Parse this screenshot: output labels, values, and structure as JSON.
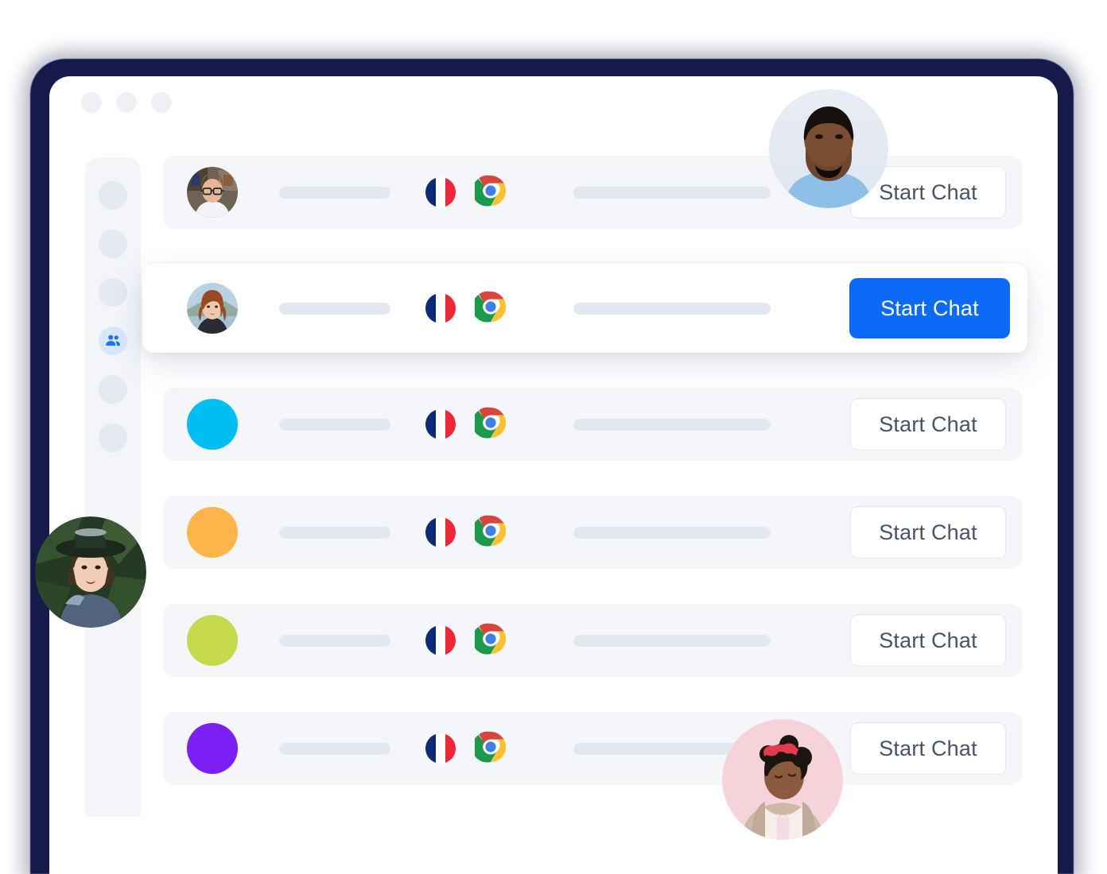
{
  "window": {
    "traffic_lights": [
      "dot-red",
      "dot-yellow",
      "dot-green"
    ]
  },
  "sidebar": {
    "items": [
      {
        "name": "nav-item-1",
        "icon": "circle-placeholder-icon",
        "active": false
      },
      {
        "name": "nav-item-2",
        "icon": "circle-placeholder-icon",
        "active": false
      },
      {
        "name": "nav-item-3",
        "icon": "circle-placeholder-icon",
        "active": false
      },
      {
        "name": "nav-item-contacts",
        "icon": "people-group-icon",
        "active": true
      },
      {
        "name": "nav-item-5",
        "icon": "circle-placeholder-icon",
        "active": false
      },
      {
        "name": "nav-item-6",
        "icon": "circle-placeholder-icon",
        "active": false
      }
    ],
    "active_index": 3,
    "active_color": "#1a73f0",
    "active_bg": "#d6e8ff",
    "idle_color": "#e5e9f0"
  },
  "list": {
    "button_label": "Start Chat",
    "rows": [
      {
        "id": "row-1",
        "avatar_type": "photo",
        "avatar_name": "avatar-man-glasses",
        "country": "france",
        "country_flag": "fr-flag-icon",
        "browser": "chrome",
        "browser_icon": "chrome-icon",
        "highlighted": false
      },
      {
        "id": "row-2",
        "avatar_type": "photo",
        "avatar_name": "avatar-woman-redhair",
        "country": "france",
        "country_flag": "fr-flag-icon",
        "browser": "chrome",
        "browser_icon": "chrome-icon",
        "highlighted": true
      },
      {
        "id": "row-3",
        "avatar_type": "color",
        "avatar_name": "avatar-color-cyan",
        "avatar_color": "#00BEF2",
        "country": "france",
        "country_flag": "fr-flag-icon",
        "browser": "chrome",
        "browser_icon": "chrome-icon",
        "highlighted": false
      },
      {
        "id": "row-4",
        "avatar_type": "color",
        "avatar_name": "avatar-color-orange",
        "avatar_color": "#FDB44B",
        "country": "france",
        "country_flag": "fr-flag-icon",
        "browser": "chrome",
        "browser_icon": "chrome-icon",
        "highlighted": false
      },
      {
        "id": "row-5",
        "avatar_type": "color",
        "avatar_name": "avatar-color-lime",
        "avatar_color": "#C5D94A",
        "country": "france",
        "country_flag": "fr-flag-icon",
        "browser": "chrome",
        "browser_icon": "chrome-icon",
        "highlighted": false
      },
      {
        "id": "row-6",
        "avatar_type": "color",
        "avatar_name": "avatar-color-purple",
        "avatar_color": "#7C1FF5",
        "country": "france",
        "country_flag": "fr-flag-icon",
        "browser": "chrome",
        "browser_icon": "chrome-icon",
        "highlighted": false
      }
    ]
  },
  "floating_avatars": [
    {
      "name": "floating-avatar-man-blue-shirt",
      "position": "top-right"
    },
    {
      "name": "floating-avatar-woman-hat",
      "position": "left"
    },
    {
      "name": "floating-avatar-woman-sunglasses",
      "position": "bottom-right"
    }
  ],
  "theme": {
    "accent": "#0b6bf7",
    "frame": "#151a4a",
    "row_bg": "#f4f6fa",
    "skeleton": "#e3e8f0",
    "button_text": "#46536b"
  }
}
